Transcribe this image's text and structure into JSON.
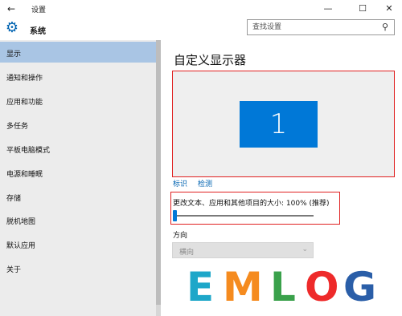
{
  "window": {
    "title": "设置",
    "back_icon": "back-arrow-icon",
    "minimize_glyph": "—",
    "maximize_glyph": "☐",
    "close_glyph": "✕"
  },
  "header": {
    "app_name": "系统",
    "icon": "gear-icon"
  },
  "search": {
    "placeholder": "查找设置",
    "icon": "search-icon"
  },
  "sidebar": {
    "items": [
      {
        "label": "显示",
        "active": true
      },
      {
        "label": "通知和操作"
      },
      {
        "label": "应用和功能"
      },
      {
        "label": "多任务"
      },
      {
        "label": "平板电脑模式"
      },
      {
        "label": "电源和睡眠"
      },
      {
        "label": "存储"
      },
      {
        "label": "脱机地图"
      },
      {
        "label": "默认应用"
      },
      {
        "label": "关于"
      }
    ]
  },
  "main": {
    "title": "自定义显示器",
    "monitor_number": "1",
    "identify_link": "标识",
    "detect_link": "检测",
    "scale_label": "更改文本、应用和其他项目的大小: 100% (推荐)",
    "scale_slider_value": 0,
    "orientation_label": "方向",
    "orientation_value": "横向"
  },
  "watermark": {
    "letters": [
      "E",
      "M",
      "L",
      "O",
      "G"
    ]
  },
  "colors": {
    "accent": "#0078d7",
    "sidebar_bg": "#ececec",
    "sidebar_active": "#a9c5e4",
    "highlight_outline": "#e02020"
  }
}
